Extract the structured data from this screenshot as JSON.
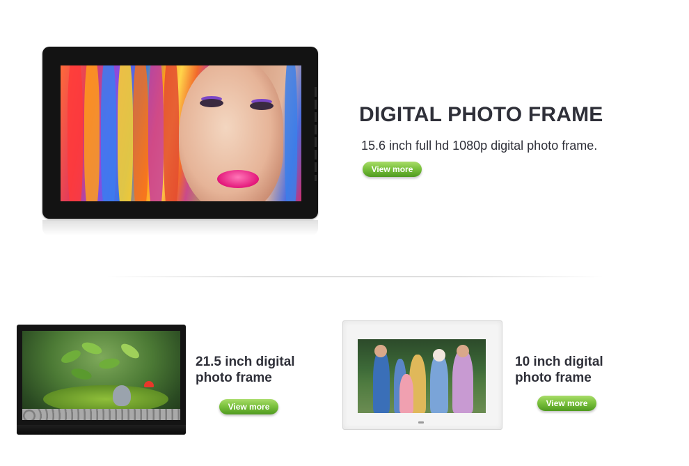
{
  "hero": {
    "title": "DIGITAL PHOTO FRAME",
    "description": "15.6 inch full hd 1080p digital photo frame.",
    "button_label": "View more"
  },
  "products": [
    {
      "title": "21.5 inch digital\nphoto frame",
      "button_label": "View more"
    },
    {
      "title": "10 inch digital\nphoto frame",
      "button_label": "View more"
    }
  ],
  "colors": {
    "text_dark": "#2f3039",
    "button_green_top": "#a9dc6a",
    "button_green_bottom": "#4f9a1f",
    "frame_black": "#131313",
    "frame_white": "#f4f4f4"
  },
  "icons": {
    "hero_screen": "portrait-image",
    "frame_21_screen": "garden-image",
    "frame_10_screen": "family-photo-image"
  }
}
